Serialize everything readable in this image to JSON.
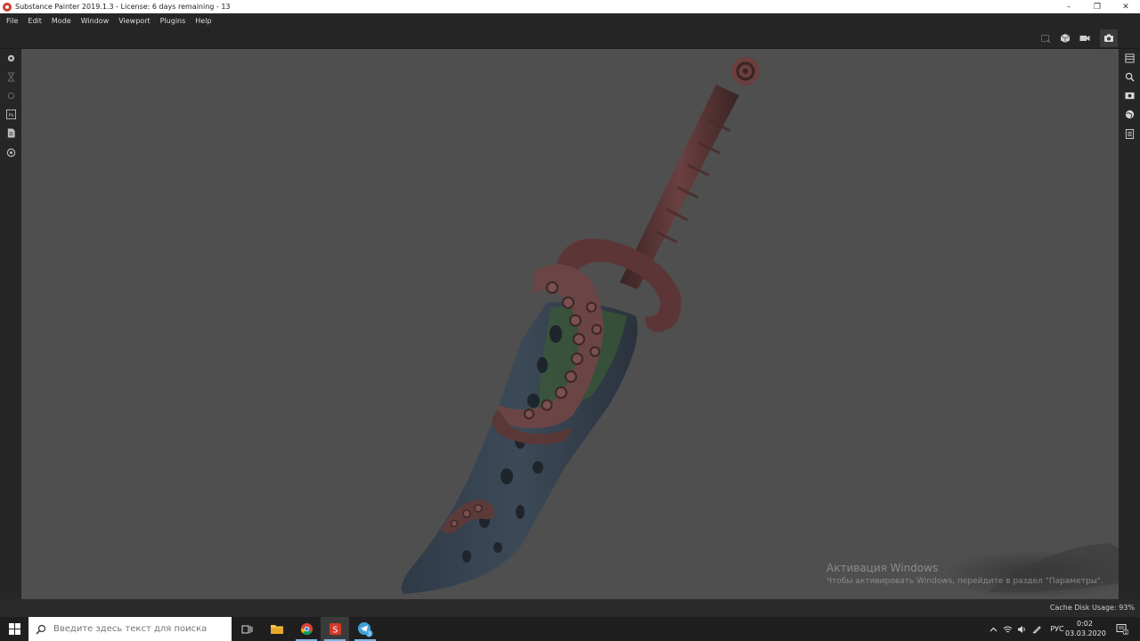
{
  "window": {
    "title": "Substance Painter 2019.1.3 - License: 6 days remaining - 13",
    "controls": {
      "minimize": "–",
      "maximize": "❐",
      "close": "✕"
    }
  },
  "menu": [
    "File",
    "Edit",
    "Mode",
    "Window",
    "Viewport",
    "Plugins",
    "Help"
  ],
  "viewport_toolbar": {
    "icons": [
      "frame-select-icon",
      "cube-display-icon",
      "camera-icon",
      "screenshot-icon"
    ]
  },
  "left_shelf": {
    "icons": [
      "layer-icon",
      "hourglass-icon",
      "brush-icon",
      "photoshop-export-icon",
      "export-doc-icon",
      "settings-icon"
    ],
    "ps_label": "Ps"
  },
  "right_shelf": {
    "icons": [
      "layers-panel-icon",
      "zoom-icon",
      "display-settings-icon",
      "environment-icon",
      "properties-icon"
    ]
  },
  "activation": {
    "title": "Активация Windows",
    "subtitle": "Чтобы активировать Windows, перейдите в раздел \"Параметры\"."
  },
  "status": {
    "cache_label": "Cache Disk Usage:",
    "cache_value": "93%"
  },
  "taskbar": {
    "search_placeholder": "Введите здесь текст для поиска",
    "apps": [
      "task-view-icon",
      "file-explorer-icon",
      "chrome-icon",
      "substance-painter-icon",
      "telegram-icon"
    ],
    "telegram_badge": "3",
    "tray": {
      "lang": "РУС",
      "time": "0:02",
      "date": "03.03.2020",
      "notifications": "2"
    }
  },
  "colors": {
    "viewport_bg": "#4f4f4f",
    "panel_bg": "#262626",
    "accent": "#d23a2a"
  }
}
